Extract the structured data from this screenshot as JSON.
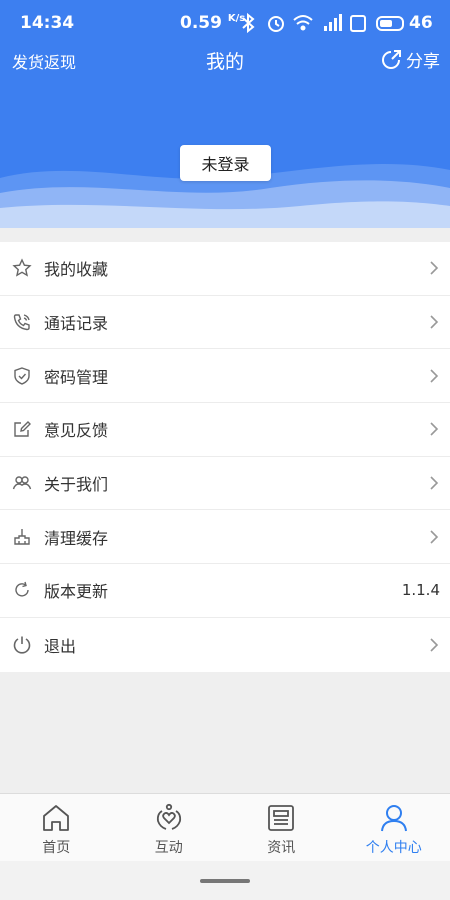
{
  "status_bar": {
    "time": "14:34",
    "net_speed": "0.59",
    "net_speed_unit": "K/s",
    "battery_level": "46",
    "icons": [
      "bluetooth-icon",
      "alarm-icon",
      "wifi-icon",
      "signal-icon",
      "hd-icon",
      "battery-icon"
    ]
  },
  "topbar": {
    "left_link": "发货返现",
    "title": "我的",
    "share_label": "分享"
  },
  "login_button": "未登录",
  "menu": {
    "items": [
      {
        "label": "我的收藏",
        "icon": "star-icon"
      },
      {
        "label": "通话记录",
        "icon": "phone-icon"
      },
      {
        "label": "密码管理",
        "icon": "shield-icon"
      },
      {
        "label": "意见反馈",
        "icon": "edit-icon"
      },
      {
        "label": "关于我们",
        "icon": "people-icon"
      },
      {
        "label": "清理缓存",
        "icon": "broom-icon"
      },
      {
        "label": "版本更新",
        "icon": "refresh-icon",
        "value": "1.1.4"
      },
      {
        "label": "退出",
        "icon": "power-icon"
      }
    ]
  },
  "bottom_nav": {
    "items": [
      {
        "label": "首页",
        "icon": "home-icon",
        "active": false
      },
      {
        "label": "互动",
        "icon": "heart-hands-icon",
        "active": false
      },
      {
        "label": "资讯",
        "icon": "news-icon",
        "active": false
      },
      {
        "label": "个人中心",
        "icon": "user-icon",
        "active": true
      }
    ]
  },
  "colors": {
    "header_blue": "#3d7ff0",
    "active_blue": "#2f7ff0",
    "page_background": "#efefef"
  }
}
